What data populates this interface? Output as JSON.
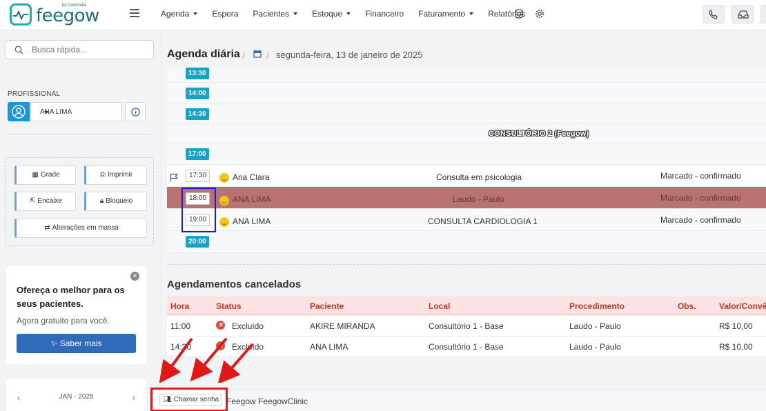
{
  "brand": {
    "name": "feegow",
    "by": "by Doctoralia"
  },
  "nav": {
    "items": [
      {
        "label": "Agenda",
        "dropdown": true
      },
      {
        "label": "Espera",
        "dropdown": false
      },
      {
        "label": "Pacientes",
        "dropdown": true
      },
      {
        "label": "Estoque",
        "dropdown": true
      },
      {
        "label": "Financeiro",
        "dropdown": false
      },
      {
        "label": "Faturamento",
        "dropdown": true
      },
      {
        "label": "Relatórios",
        "dropdown": false
      }
    ],
    "icons": [
      "database-icon",
      "gear-icon",
      "phone-icon",
      "inbox-icon"
    ]
  },
  "sidebar": {
    "search_placeholder": "Busca rápida...",
    "profissional_label": "PROFISSIONAL",
    "profissional_value": "ANA LIMA",
    "actions": {
      "grade": "Grade",
      "imprimir": "Imprimir",
      "encaixe": "Encaixe",
      "bloqueio": "Bloqueio",
      "massa": "Alterações em massa"
    },
    "promo": {
      "title": "Ofereça o melhor para os seus pacientes.",
      "subtitle": "Agora gratuito para você.",
      "button": "Saber mais"
    },
    "calendar": {
      "month": "JAN - 2025"
    }
  },
  "header": {
    "title": "Agenda diária",
    "date": "segunda-feira, 13 de janeiro de 2025"
  },
  "agenda": {
    "slots": [
      {
        "time": "13:30"
      },
      {
        "time": "14:00"
      },
      {
        "time": "14:30"
      },
      {
        "time": "17:00"
      },
      {
        "time": "20:00"
      }
    ],
    "consultorio": "CONSULTÓRIO 2 (Feegow)",
    "appointments": [
      {
        "time": "17:30",
        "patient": "Ana Clara",
        "procedure": "Consulta em psicologia",
        "status": "Marcado - confirmado"
      },
      {
        "time": "18:00",
        "patient": "ANA LIMA",
        "procedure": "Laudo - Paulo",
        "status": "Marcado - confirmado"
      },
      {
        "time": "19:00",
        "patient": "ANA LIMA",
        "procedure": "CONSULTA CARDIOLOGIA 1",
        "status": "Marcado - confirmado"
      }
    ]
  },
  "cancelled": {
    "title": "Agendamentos cancelados",
    "columns": [
      "Hora",
      "Status",
      "Paciente",
      "Local",
      "Procedimento",
      "Obs.",
      "Valor/Convê"
    ],
    "rows": [
      {
        "hora": "11:00",
        "status": "Excluído",
        "paciente": "AKIRE MIRANDA",
        "local": "Consultório 1 - Base",
        "procedimento": "Laudo - Paulo",
        "obs": "",
        "valor": "R$ 10,00"
      },
      {
        "hora": "14:30",
        "status": "Excluído",
        "paciente": "ANA LIMA",
        "local": "Consultório 1 - Base",
        "procedimento": "Laudo - Paulo",
        "obs": "",
        "valor": "R$ 10,00"
      }
    ]
  },
  "footer": {
    "chamar_senha": "Chamar senha",
    "text": "Feegow FeegowClinic"
  },
  "colors": {
    "accent": "#17a2c8",
    "brand": "#1bb0a7",
    "highlight_row": "#b87272",
    "annotation_red": "#e01818",
    "annotation_blue": "#1b1bd6"
  }
}
